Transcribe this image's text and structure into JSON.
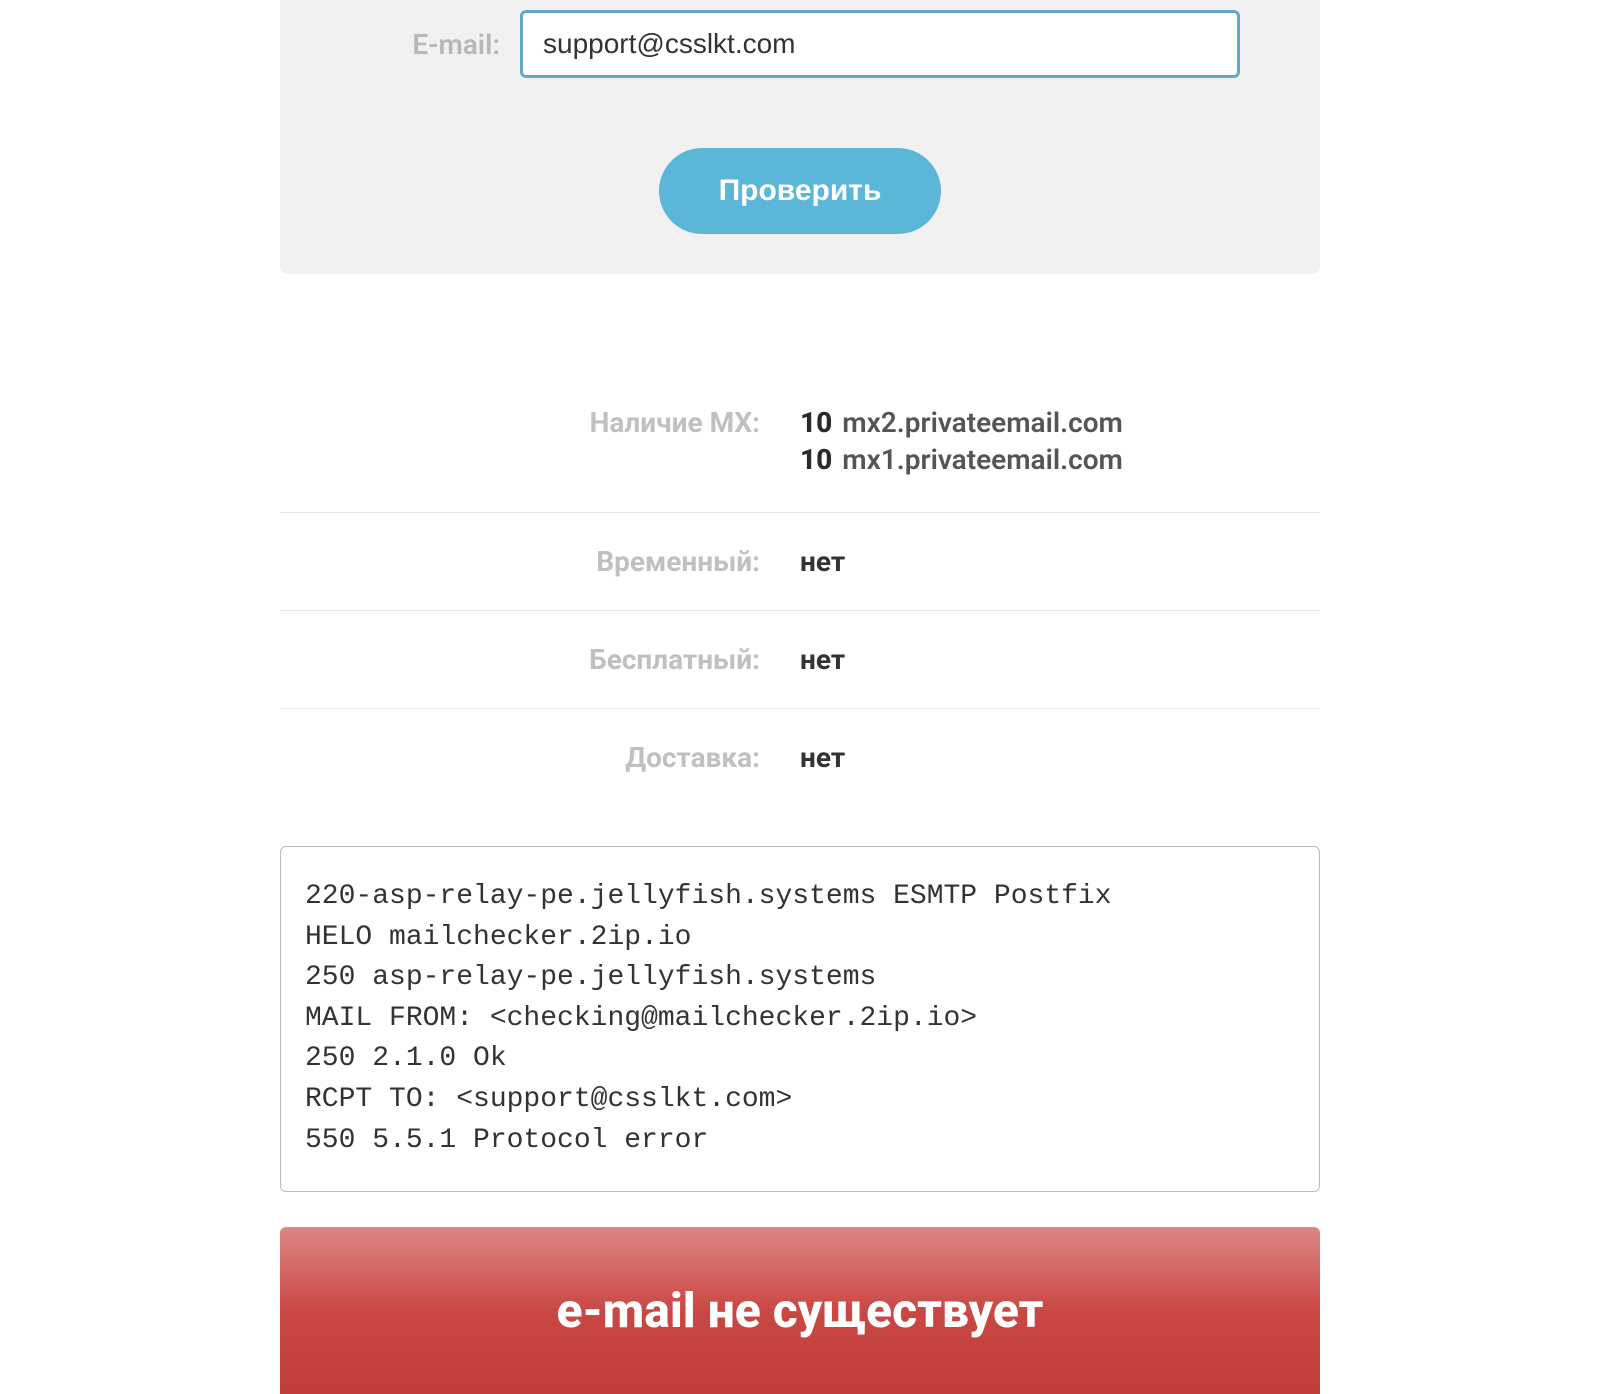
{
  "form": {
    "label": "E-mail:",
    "email_value": "support@csslkt.com",
    "check_button": "Проверить"
  },
  "results": {
    "mx_label": "Наличие MX:",
    "mx_records": [
      {
        "priority": "10",
        "host": "mx2.privateemail.com"
      },
      {
        "priority": "10",
        "host": "mx1.privateemail.com"
      }
    ],
    "temporary_label": "Временный:",
    "temporary_value": "нет",
    "free_label": "Бесплатный:",
    "free_value": "нет",
    "delivery_label": "Доставка:",
    "delivery_value": "нет"
  },
  "log": "220-asp-relay-pe.jellyfish.systems ESMTP Postfix\nHELO mailchecker.2ip.io\n250 asp-relay-pe.jellyfish.systems\nMAIL FROM: <checking@mailchecker.2ip.io>\n250 2.1.0 Ok\nRCPT TO: <support@csslkt.com>\n550 5.5.1 Protocol error",
  "status": "e-mail не существует"
}
